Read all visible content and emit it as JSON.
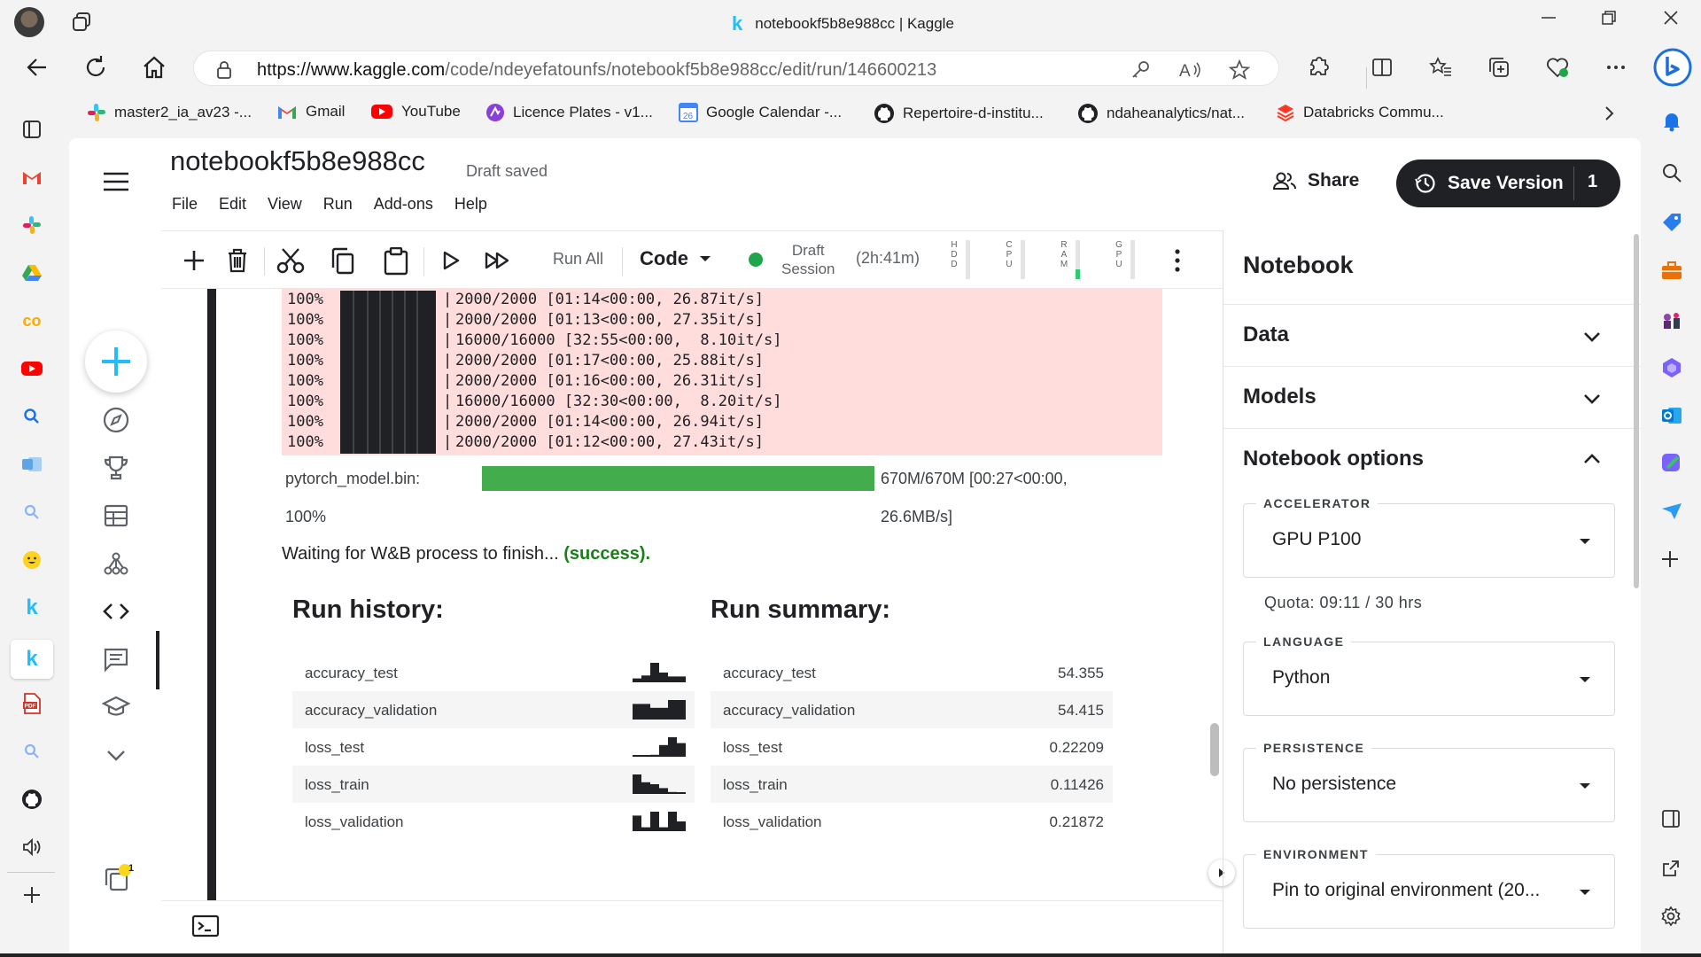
{
  "browser": {
    "tab_title": "notebookf5b8e988cc | Kaggle",
    "url_host": "https://www.kaggle.com",
    "url_path": "/code/ndeyefatounfs/notebookf5b8e988cc/edit/run/146600213"
  },
  "bookmarks": [
    {
      "label": "master2_ia_av23 -...",
      "icon": "slack-icon"
    },
    {
      "label": "Gmail",
      "icon": "gmail-icon"
    },
    {
      "label": "YouTube",
      "icon": "youtube-icon"
    },
    {
      "label": "Licence Plates - v1...",
      "icon": "roboflow-icon"
    },
    {
      "label": "Google Calendar -...",
      "icon": "calendar-icon"
    },
    {
      "label": "Repertoire-d-institu...",
      "icon": "github-icon"
    },
    {
      "label": "ndaheanalytics/nat...",
      "icon": "github-icon"
    },
    {
      "label": "Databricks Commu...",
      "icon": "databricks-icon"
    }
  ],
  "notebook": {
    "title": "notebookf5b8e988cc",
    "status": "Draft saved",
    "menus": [
      "File",
      "Edit",
      "View",
      "Run",
      "Add-ons",
      "Help"
    ],
    "share_label": "Share",
    "save_label": "Save Version",
    "save_count": "1"
  },
  "toolbar": {
    "run_all": "Run All",
    "cell_type": "Code",
    "session_line1": "Draft",
    "session_line2": "Session",
    "session_time": "(2h:41m)",
    "meters": [
      {
        "label": "HDD",
        "level": 0.0
      },
      {
        "label": "CPU",
        "level": 0.0
      },
      {
        "label": "RAM",
        "level": 0.25
      },
      {
        "label": "GPU",
        "level": 0.0
      }
    ],
    "status_color": "#20a64a"
  },
  "output": {
    "progress_lines": [
      {
        "pct": "100%",
        "text": "2000/2000 [01:14<00:00, 26.87it/s]"
      },
      {
        "pct": "100%",
        "text": "2000/2000 [01:13<00:00, 27.35it/s]"
      },
      {
        "pct": "100%",
        "text": "16000/16000 [32:55<00:00,  8.10it/s]"
      },
      {
        "pct": "100%",
        "text": "2000/2000 [01:17<00:00, 25.88it/s]"
      },
      {
        "pct": "100%",
        "text": "2000/2000 [01:16<00:00, 26.31it/s]"
      },
      {
        "pct": "100%",
        "text": "16000/16000 [32:30<00:00,  8.20it/s]"
      },
      {
        "pct": "100%",
        "text": "2000/2000 [01:14<00:00, 26.94it/s]"
      },
      {
        "pct": "100%",
        "text": "2000/2000 [01:12<00:00, 27.43it/s]"
      }
    ],
    "model_file": "pytorch_model.bin:",
    "model_pct": "100%",
    "model_progress": 1.0,
    "model_stat1": "670M/670M [00:27<00:00,",
    "model_stat2": "26.6MB/s]",
    "wandb_text": "Waiting for W&B process to finish...",
    "wandb_status": "(success).",
    "history_title": "Run history:",
    "summary_title": "Run summary:",
    "history": [
      {
        "key": "accuracy_test",
        "spark": [
          0.2,
          0.35,
          1.0,
          0.5,
          0.3,
          0.3
        ]
      },
      {
        "key": "accuracy_validation",
        "spark": [
          0.8,
          0.8,
          0.6,
          0.6,
          1.0,
          1.0
        ]
      },
      {
        "key": "loss_test",
        "spark": [
          0.05,
          0.05,
          0.1,
          0.6,
          1.0,
          0.7
        ]
      },
      {
        "key": "loss_train",
        "spark": [
          1.0,
          0.6,
          0.5,
          0.3,
          0.1,
          0.05
        ]
      },
      {
        "key": "loss_validation",
        "spark": [
          0.8,
          0.2,
          1.0,
          0.2,
          1.0,
          0.5
        ]
      }
    ],
    "summary": [
      {
        "key": "accuracy_test",
        "value": "54.355"
      },
      {
        "key": "accuracy_validation",
        "value": "54.415"
      },
      {
        "key": "loss_test",
        "value": "0.22209"
      },
      {
        "key": "loss_train",
        "value": "0.11426"
      },
      {
        "key": "loss_validation",
        "value": "0.21872"
      }
    ]
  },
  "right_panel": {
    "title": "Notebook",
    "sections": [
      "Data",
      "Models",
      "Notebook options"
    ],
    "accelerator_label": "ACCELERATOR",
    "accelerator_value": "GPU P100",
    "quota": "Quota: 09:11 / 30 hrs",
    "language_label": "LANGUAGE",
    "language_value": "Python",
    "persistence_label": "PERSISTENCE",
    "persistence_value": "No persistence",
    "environment_label": "ENVIRONMENT",
    "environment_value": "Pin to original environment (20..."
  },
  "left_nav_badge": "1",
  "colors": {
    "accent": "#20beff",
    "kaggle_fab_plus": "#20beff",
    "stderr_bg": "#ffdddd",
    "progress_green": "#43ad4e"
  }
}
